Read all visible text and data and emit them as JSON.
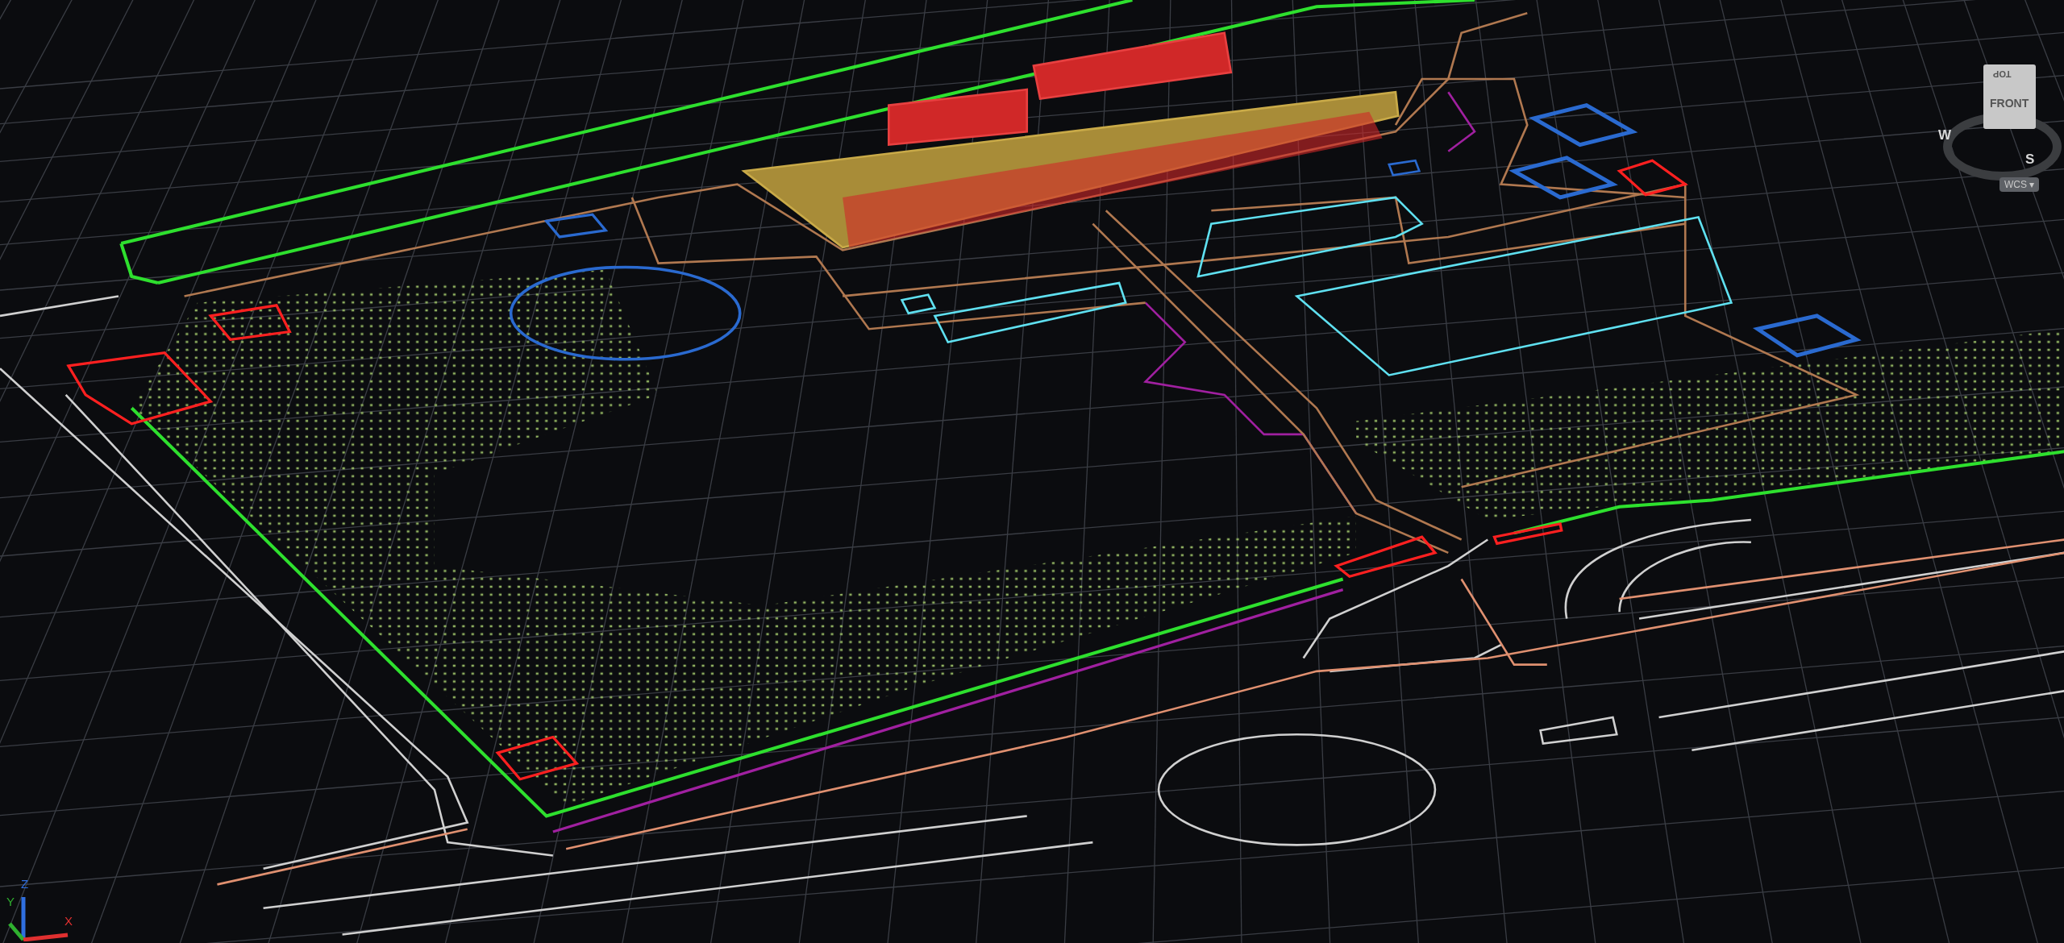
{
  "viewcube": {
    "top_face": "TOP",
    "front_face": "FRONT",
    "compass": [
      {
        "label": "W",
        "kind": "west"
      },
      {
        "label": "S",
        "kind": "south"
      }
    ]
  },
  "coordinate_system": {
    "label": "WCS",
    "caret": "▾"
  },
  "ucs_icon": {
    "axes": [
      {
        "label": "Z",
        "color": "#2f6fe0"
      },
      {
        "label": "Y",
        "color": "#2fb02f"
      },
      {
        "label": "X",
        "color": "#e03030"
      }
    ]
  }
}
